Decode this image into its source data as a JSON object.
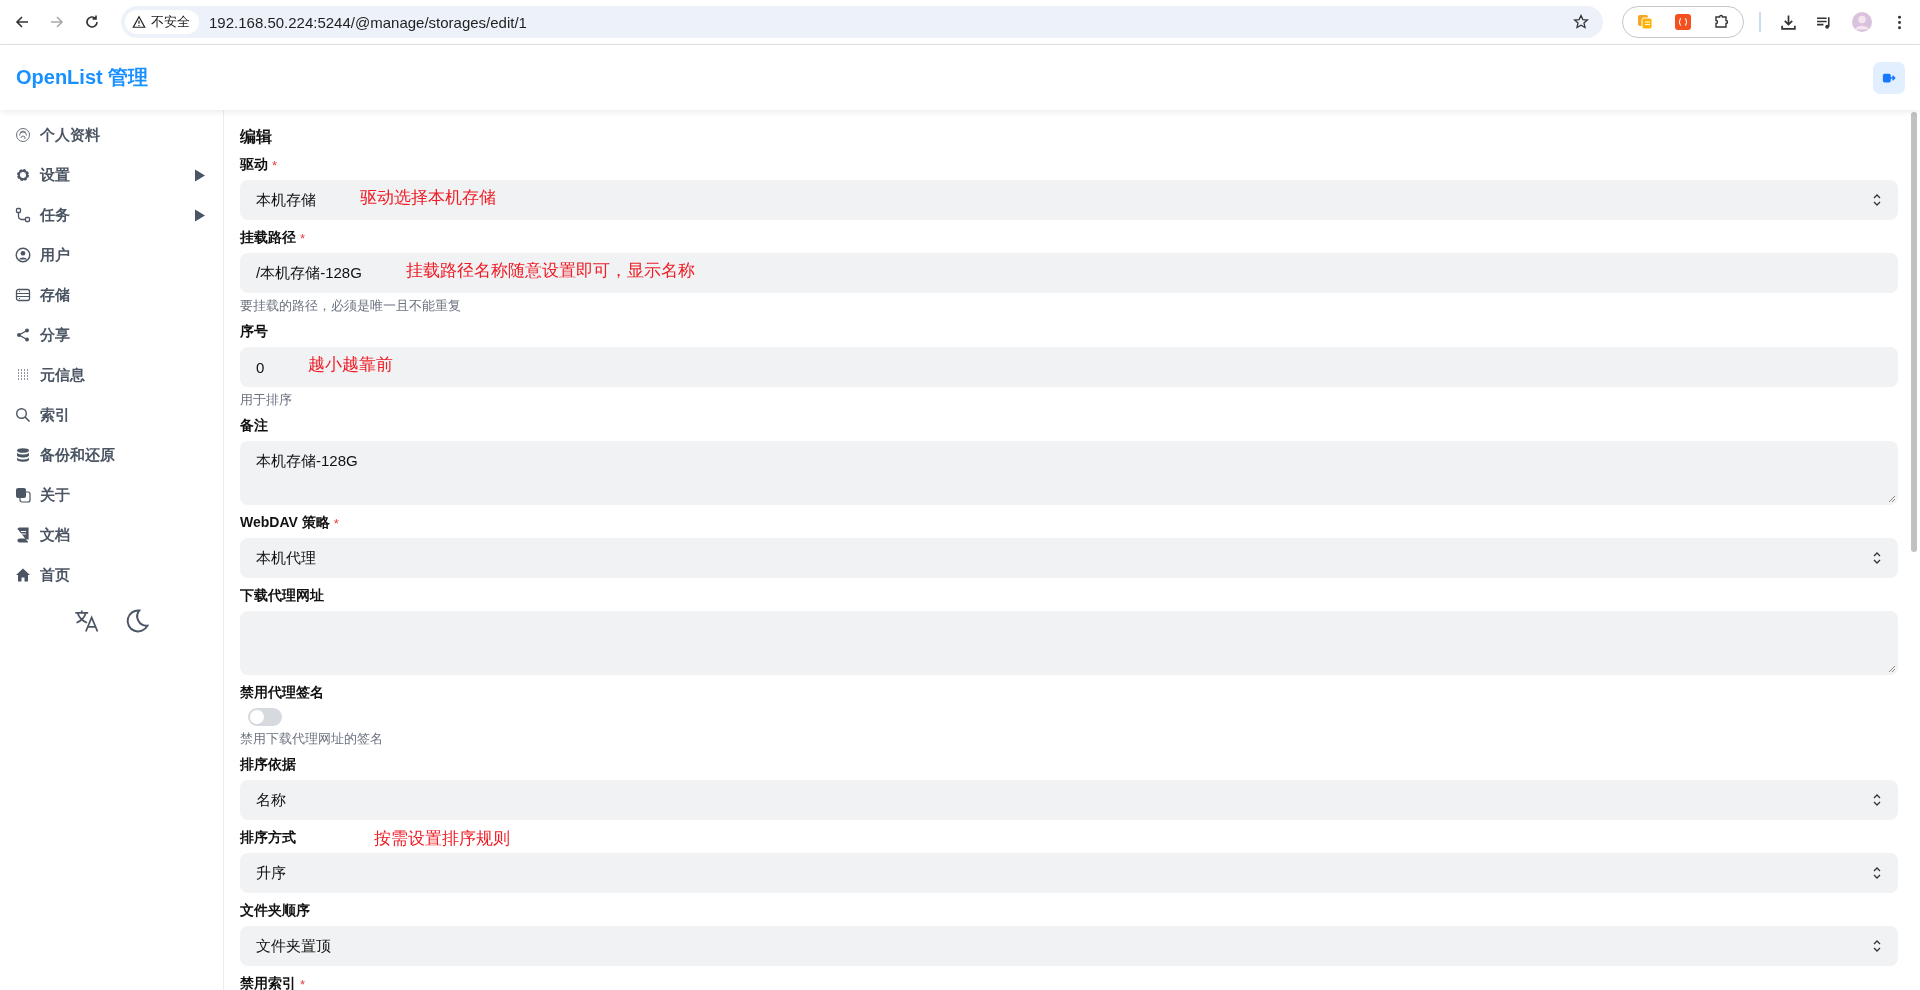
{
  "browser": {
    "security_label": "不安全",
    "url": "192.168.50.224:5244/@manage/storages/edit/1"
  },
  "header": {
    "title": "OpenList 管理"
  },
  "sidebar": {
    "items": [
      {
        "label": "个人资料",
        "expandable": false
      },
      {
        "label": "设置",
        "expandable": true
      },
      {
        "label": "任务",
        "expandable": true
      },
      {
        "label": "用户",
        "expandable": false
      },
      {
        "label": "存储",
        "expandable": false
      },
      {
        "label": "分享",
        "expandable": false
      },
      {
        "label": "元信息",
        "expandable": false
      },
      {
        "label": "索引",
        "expandable": false
      },
      {
        "label": "备份和还原",
        "expandable": false
      },
      {
        "label": "关于",
        "expandable": false
      },
      {
        "label": "文档",
        "expandable": false
      },
      {
        "label": "首页",
        "expandable": false
      }
    ]
  },
  "form": {
    "title": "编辑",
    "fields": [
      {
        "kind": "select",
        "label": "驱动",
        "required_mark": "*",
        "value": "本机存储",
        "note": "驱动选择本机存储"
      },
      {
        "kind": "input",
        "label": "挂载路径",
        "required_mark": "*",
        "value": "/本机存储-128G",
        "help": "要挂载的路径，必须是唯一且不能重复",
        "note": "挂载路径名称随意设置即可，显示名称"
      },
      {
        "kind": "input",
        "label": "序号",
        "value": "0",
        "help": "用于排序",
        "note": "越小越靠前"
      },
      {
        "kind": "textarea",
        "label": "备注",
        "value": "本机存储-128G"
      },
      {
        "kind": "select",
        "label": "WebDAV 策略",
        "required_mark": "*",
        "value": "本机代理"
      },
      {
        "kind": "textarea",
        "label": "下载代理网址"
      },
      {
        "kind": "switch",
        "label": "禁用代理签名",
        "on": false,
        "help": "禁用下载代理网址的签名"
      },
      {
        "kind": "select",
        "label": "排序依据",
        "value": "名称"
      },
      {
        "kind": "select",
        "label": "排序方式",
        "value": "升序",
        "label_note": "按需设置排序规则"
      },
      {
        "kind": "select",
        "label": "文件夹顺序",
        "value": "文件夹置顶"
      },
      {
        "kind": "label",
        "label": "禁用索引",
        "required_mark": "*"
      }
    ]
  }
}
